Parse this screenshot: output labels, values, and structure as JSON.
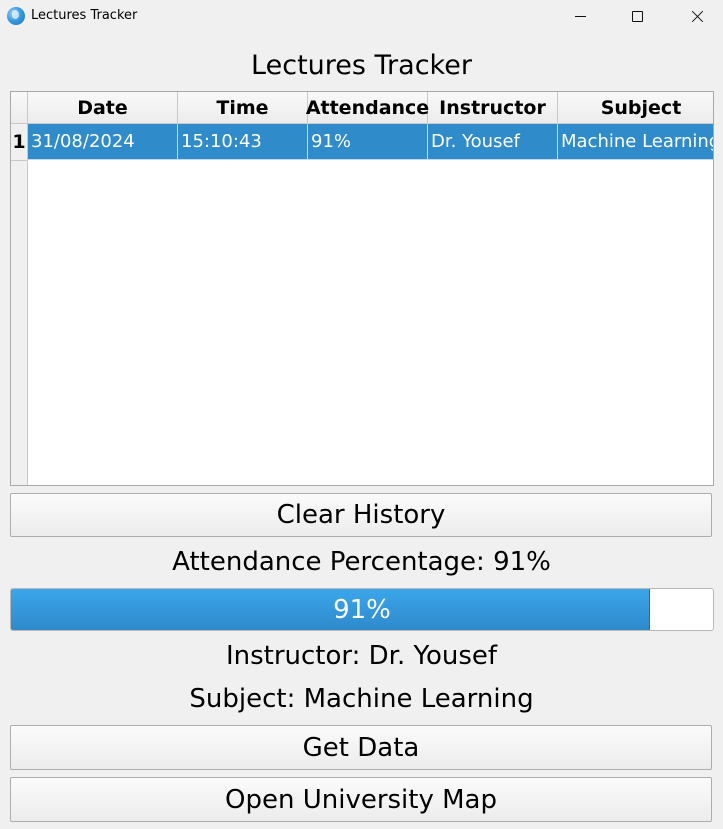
{
  "window": {
    "title": "Lectures Tracker",
    "icon": "globe-icon",
    "controls": [
      "minimize",
      "maximize",
      "close"
    ]
  },
  "heading": "Lectures Tracker",
  "table": {
    "columns": [
      "Date",
      "Time",
      "Attendance",
      "Instructor",
      "Subject"
    ],
    "rows": [
      {
        "index": "1",
        "selected": true,
        "cells": [
          "31/08/2024",
          "15:10:43",
          "91%",
          "Dr. Yousef",
          "Machine Learning"
        ]
      }
    ]
  },
  "buttons": {
    "clear_history": "Clear History",
    "get_data": "Get Data",
    "open_map": "Open University Map"
  },
  "attendance": {
    "label": "Attendance Percentage: 91%",
    "progress_value": 91,
    "progress_text": "91%"
  },
  "instructor_label": "Instructor: Dr. Yousef",
  "subject_label": "Subject: Machine Learning",
  "colors": {
    "selection": "#2f8bc9",
    "progress": "#3399dd",
    "background": "#f0f0f0"
  }
}
